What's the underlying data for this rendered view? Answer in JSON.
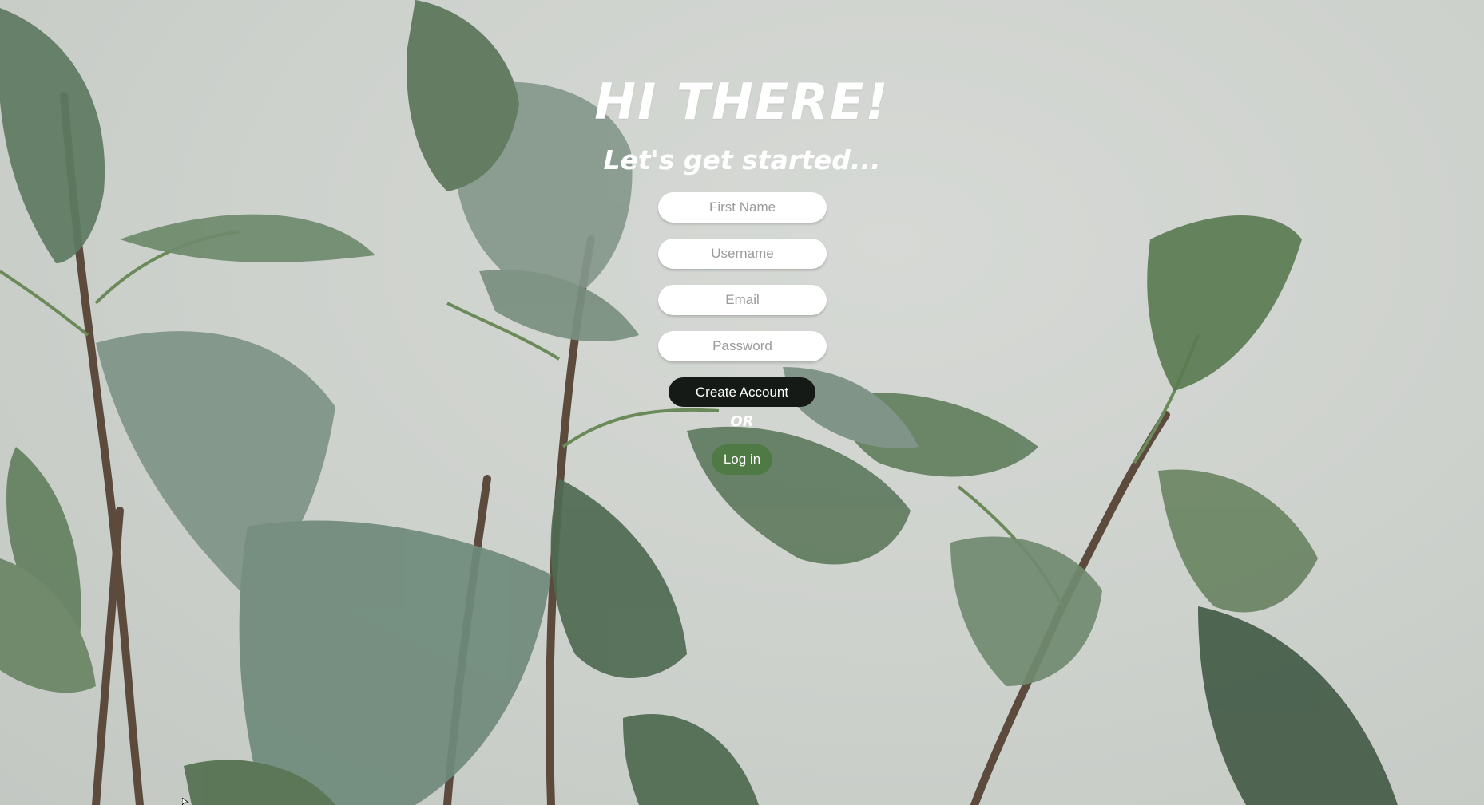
{
  "heading": {
    "title": "HI THERE!",
    "subtitle": "Let's get started..."
  },
  "form": {
    "first_name_placeholder": "First Name",
    "username_placeholder": "Username",
    "email_placeholder": "Email",
    "password_placeholder": "Password",
    "create_label": "Create Account",
    "or_label": "OR",
    "login_label": "Log in"
  },
  "colors": {
    "create_button": "#161a16",
    "login_button": "#4f7a45",
    "background": "#cfd3cf",
    "leaf": "#5f7a62"
  }
}
